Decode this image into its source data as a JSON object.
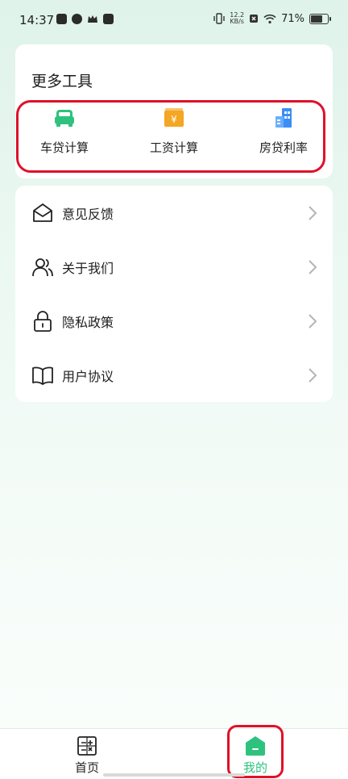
{
  "status_bar": {
    "time": "14:37",
    "net_speed_value": "12.2",
    "net_speed_unit": "KB/s",
    "battery": "71%"
  },
  "tools": {
    "title": "更多工具",
    "items": [
      {
        "label": "车贷计算",
        "icon": "car-icon",
        "color": "#2fc27f"
      },
      {
        "label": "工资计算",
        "icon": "wallet-yen-icon",
        "color": "#f5a623"
      },
      {
        "label": "房贷利率",
        "icon": "building-icon",
        "color": "#3a8ef6"
      }
    ]
  },
  "menu": {
    "items": [
      {
        "label": "意见反馈",
        "icon": "envelope-icon"
      },
      {
        "label": "关于我们",
        "icon": "users-icon"
      },
      {
        "label": "隐私政策",
        "icon": "lock-icon"
      },
      {
        "label": "用户协议",
        "icon": "book-icon"
      }
    ]
  },
  "bottom_nav": {
    "items": [
      {
        "label": "首页",
        "icon": "calculator-icon",
        "active": false
      },
      {
        "label": "我的",
        "icon": "home-icon",
        "active": true
      }
    ],
    "active_color": "#2fc27f"
  },
  "yen_symbol": "¥"
}
